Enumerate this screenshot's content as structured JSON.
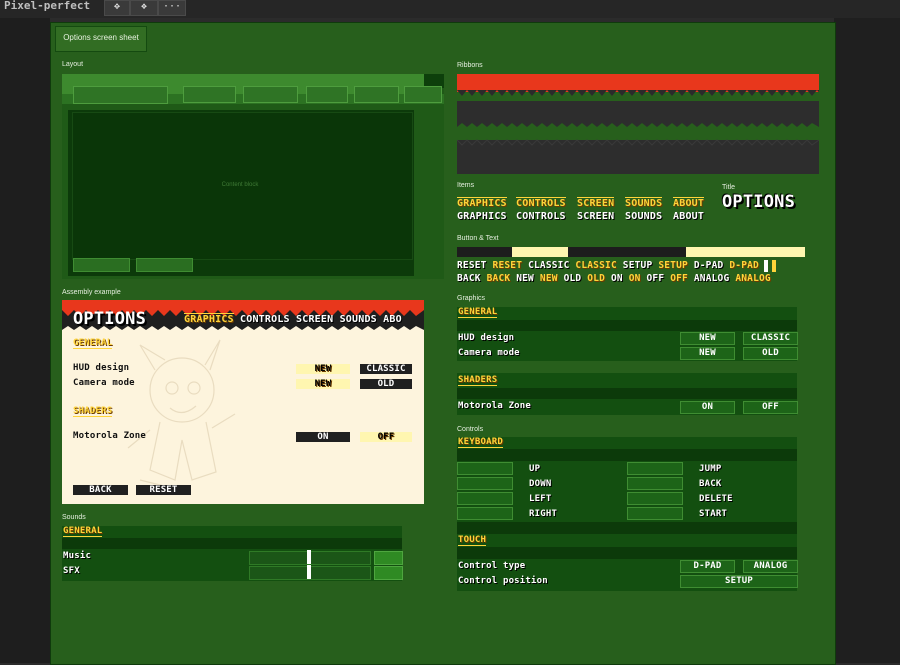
{
  "toolbar": {
    "title": "Pixel-perfect",
    "more": "···"
  },
  "sheet": {
    "tab": "Options screen sheet"
  },
  "sections": {
    "layout": "Layout",
    "ribbons": "Ribbons",
    "items": "Items",
    "title": "Title",
    "button_text": "Button & Text",
    "assembly": "Assembly example",
    "graphics": "Graphics",
    "controls": "Controls",
    "sounds": "Sounds"
  },
  "layout": {
    "content_label": "Content block"
  },
  "title_text": "OPTIONS",
  "items": {
    "row1": [
      "GRAPHICS",
      "CONTROLS",
      "SCREEN",
      "SOUNDS",
      "ABOUT"
    ],
    "row2": [
      "GRAPHICS",
      "CONTROLS",
      "SCREEN",
      "SOUNDS",
      "ABOUT"
    ]
  },
  "button_text": {
    "row1": [
      "RESET",
      "RESET",
      "CLASSIC",
      "CLASSIC",
      "SETUP",
      "SETUP",
      "D-PAD",
      "D-PAD"
    ],
    "row2": [
      "BACK",
      "BACK",
      "NEW",
      "NEW",
      "OLD",
      "OLD",
      "ON",
      "ON",
      "OFF",
      "OFF",
      "ANALOG",
      "ANALOG"
    ]
  },
  "assembly": {
    "title": "OPTIONS",
    "tabs": [
      "GRAPHICS",
      "CONTROLS",
      "SCREEN",
      "SOUNDS",
      "ABO"
    ],
    "general": "GENERAL",
    "hud": "HUD design",
    "camera": "Camera mode",
    "hud_new": "NEW",
    "hud_classic": "CLASSIC",
    "cam_new": "NEW",
    "cam_old": "OLD",
    "shaders": "SHADERS",
    "motorola": "Motorola Zone",
    "on": "ON",
    "off": "OFF",
    "back": "BACK",
    "reset": "RESET"
  },
  "graphics": {
    "general": "GENERAL",
    "hud": "HUD design",
    "camera": "Camera mode",
    "new1": "NEW",
    "classic": "CLASSIC",
    "new2": "NEW",
    "old": "OLD",
    "shaders": "SHADERS",
    "motorola": "Motorola Zone",
    "on": "ON",
    "off": "OFF"
  },
  "controls": {
    "keyboard": "KEYBOARD",
    "left_keys": [
      "UP",
      "DOWN",
      "LEFT",
      "RIGHT"
    ],
    "right_keys": [
      "JUMP",
      "BACK",
      "DELETE",
      "START"
    ],
    "touch": "TOUCH",
    "control_type": "Control type",
    "control_position": "Control position",
    "dpad": "D-PAD",
    "analog": "ANALOG",
    "setup": "SETUP"
  },
  "sounds": {
    "general": "GENERAL",
    "music": "Music",
    "sfx": "SFX"
  },
  "colors": {
    "accent_red": "#e8371c",
    "yellow": "#ffd43a",
    "green": "#275f1c"
  }
}
